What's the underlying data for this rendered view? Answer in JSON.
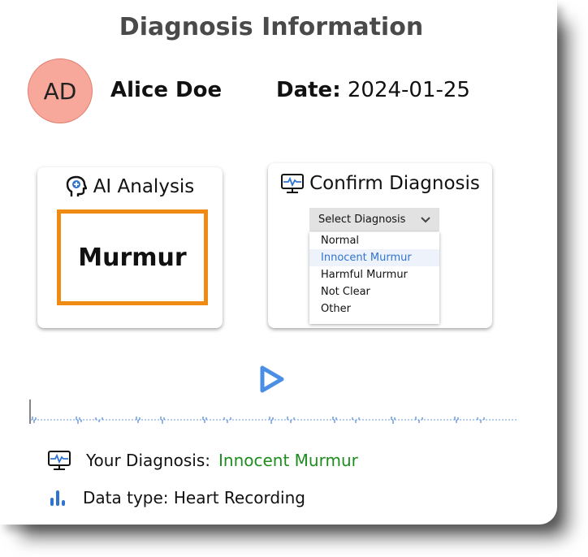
{
  "header": {
    "title": "Diagnosis Information"
  },
  "patient": {
    "initials": "AD",
    "name": "Alice Doe",
    "date_label": "Date:",
    "date_value": "2024-01-25"
  },
  "ai_analysis": {
    "title": "AI Analysis",
    "result": "Murmur",
    "accent_color": "#ef8a12"
  },
  "confirm": {
    "title": "Confirm Diagnosis",
    "select_label": "Select Diagnosis",
    "options": [
      "Normal",
      "Innocent Murmur",
      "Harmful Murmur",
      "Not Clear",
      "Other"
    ],
    "highlighted_index": 1
  },
  "player": {
    "play_icon": "play-icon"
  },
  "summary": {
    "diagnosis_label": "Your Diagnosis:",
    "diagnosis_value": "Innocent Murmur",
    "data_type_label": "Data type: Heart Recording",
    "diagnosis_color": "#1e8c1e"
  }
}
